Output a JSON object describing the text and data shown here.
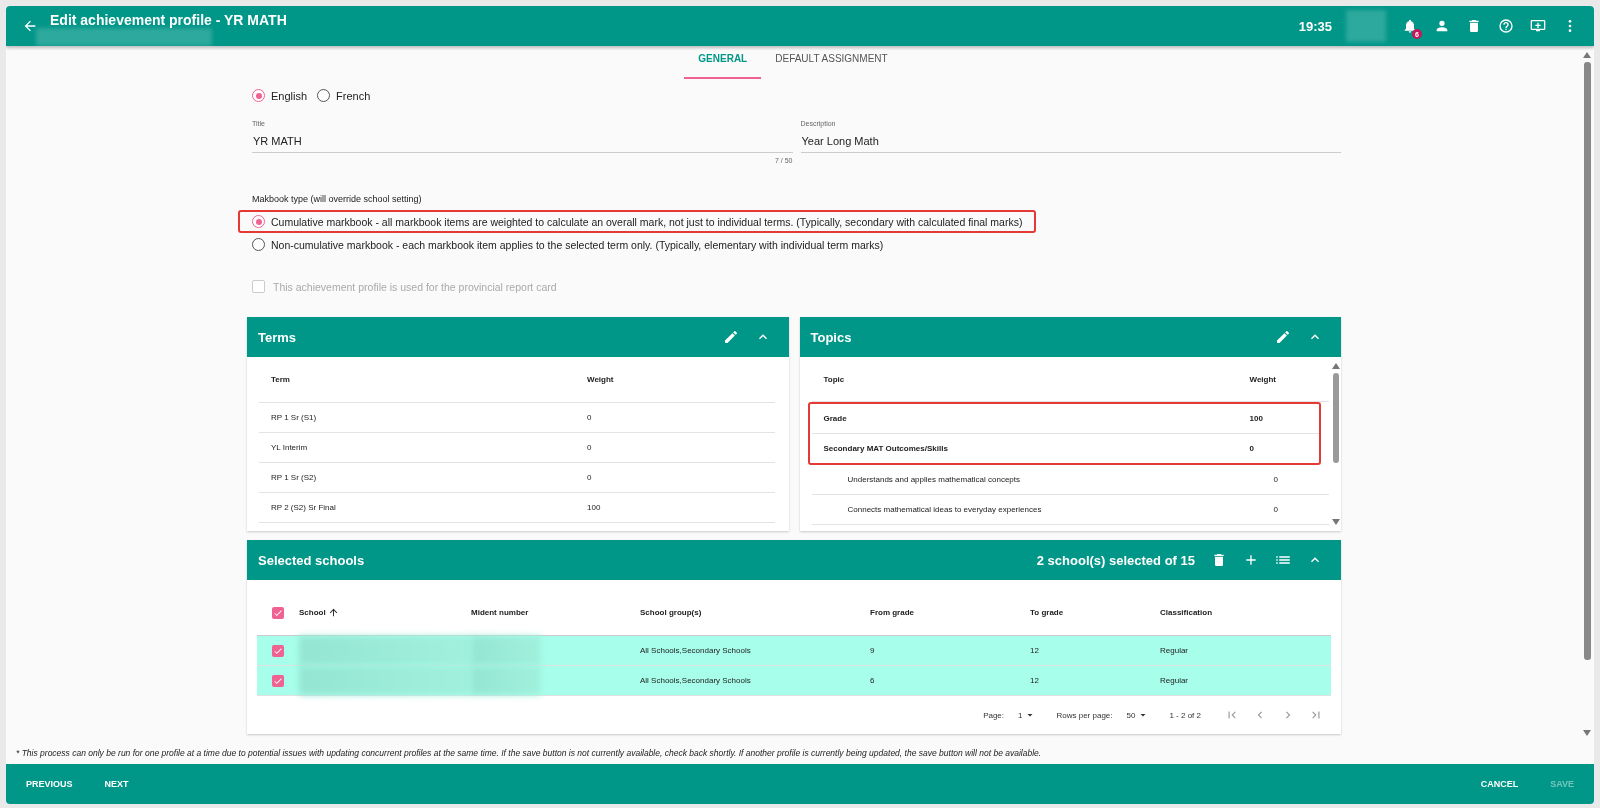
{
  "header": {
    "title": "Edit achievement profile - YR MATH",
    "time": "19:35",
    "notification_count": "6"
  },
  "tabs": [
    {
      "label": "GENERAL",
      "selected": true
    },
    {
      "label": "DEFAULT ASSIGNMENT",
      "selected": false
    }
  ],
  "languages": [
    {
      "label": "English",
      "selected": true
    },
    {
      "label": "French",
      "selected": false
    }
  ],
  "fields": [
    {
      "label": "Title",
      "value": "YR MATH",
      "counter": "7 / 50"
    },
    {
      "label": "Description",
      "value": "Year Long Math"
    }
  ],
  "markbook_type": {
    "label": "Makbook type (will override school setting)",
    "options": [
      {
        "label": "Cumulative markbook - all markbook items are weighted to calculate an overall mark, not just to individual terms. (Typically, secondary with calculated final marks)",
        "selected": true,
        "highlighted": true
      },
      {
        "label": "Non-cumulative markbook - each markbook item applies to the selected term only. (Typically, elementary with individual term marks)",
        "selected": false,
        "highlighted": false
      }
    ]
  },
  "provincial_checkbox": {
    "label": "This achievement profile is used for the provincial report card",
    "checked": false,
    "disabled": true
  },
  "terms": {
    "title": "Terms",
    "columns": [
      "Term",
      "Weight"
    ],
    "rows": [
      {
        "term": "RP 1 Sr (S1)",
        "weight": "0"
      },
      {
        "term": "YL Interim",
        "weight": "0"
      },
      {
        "term": "RP 1 Sr (S2)",
        "weight": "0"
      },
      {
        "term": "RP 2 (S2) Sr Final",
        "weight": "100"
      }
    ]
  },
  "topics": {
    "title": "Topics",
    "columns": [
      "Topic",
      "Weight"
    ],
    "rows": [
      {
        "topic": "Grade",
        "weight": "100",
        "highlighted": true
      },
      {
        "topic": "Secondary MAT Outcomes/Skills",
        "weight": "0",
        "highlighted": true,
        "children": [
          {
            "topic": "Understands and applies mathematical concepts",
            "weight": "0"
          },
          {
            "topic": "Connects mathematical ideas to everyday experiences",
            "weight": "0"
          }
        ]
      }
    ]
  },
  "schools": {
    "title": "Selected schools",
    "summary": "2 school(s) selected of 15",
    "all_checked": true,
    "columns": [
      "School",
      "Mident number",
      "School group(s)",
      "From grade",
      "To grade",
      "Classification"
    ],
    "rows": [
      {
        "checked": true,
        "school_groups": "All Schools,Secondary Schools",
        "from_grade": "9",
        "to_grade": "12",
        "classification": "Regular"
      },
      {
        "checked": true,
        "school_groups": "All Schools,Secondary Schools",
        "from_grade": "6",
        "to_grade": "12",
        "classification": "Regular"
      }
    ],
    "pagination": {
      "page_label": "Page:",
      "page": "1",
      "rows_label": "Rows per page:",
      "rows": "50",
      "range": "1 - 2 of 2"
    }
  },
  "footnote": "* This process can only be run for one profile at a time due to potential issues with updating concurrent profiles at the same time. If the save button is not currently available, check back shortly. If another profile is currently being updated, the save button will not be available.",
  "footer": {
    "left_buttons": [
      {
        "label": "PREVIOUS",
        "disabled": false
      },
      {
        "label": "NEXT",
        "disabled": false
      }
    ],
    "right_buttons": [
      {
        "label": "CANCEL",
        "disabled": false
      },
      {
        "label": "SAVE",
        "disabled": true
      }
    ]
  }
}
